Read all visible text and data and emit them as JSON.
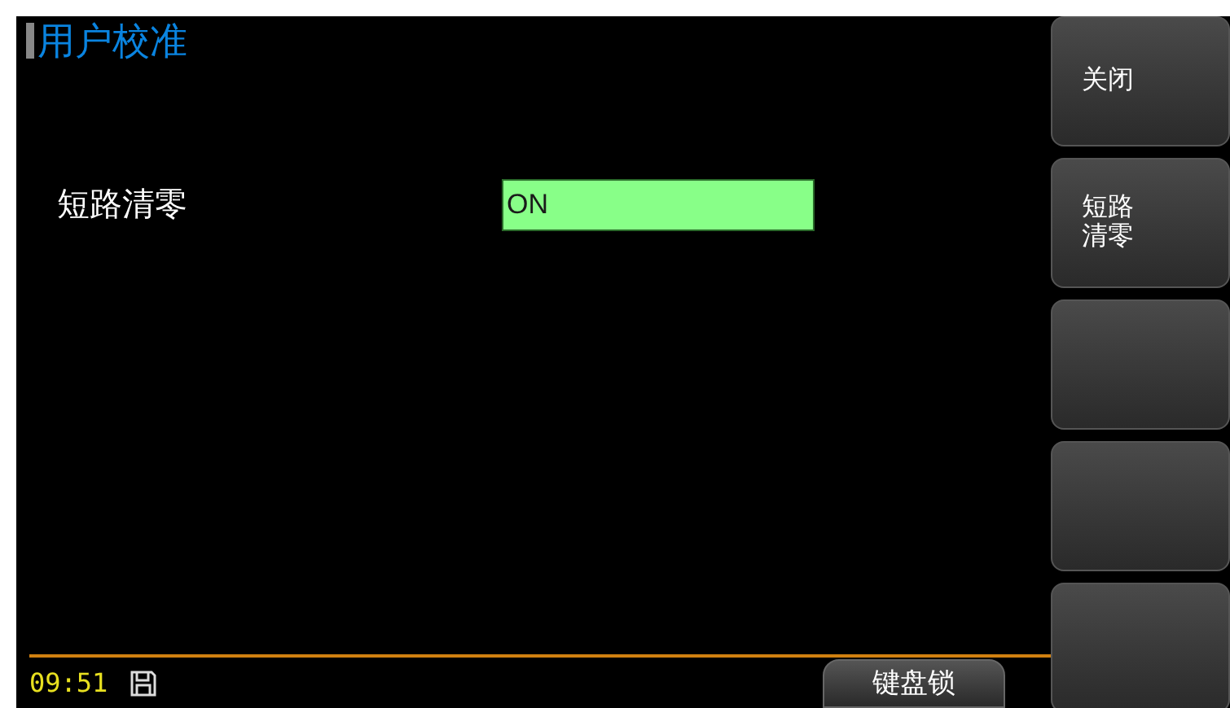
{
  "title": "用户校准",
  "settings": [
    {
      "label": "短路清零",
      "value": "ON",
      "selected": true
    }
  ],
  "status_bar": {
    "time": "09:51",
    "button": "键盘锁"
  },
  "soft_keys": [
    {
      "kind": "label",
      "label": "关闭"
    },
    {
      "kind": "label",
      "label": "短路清零"
    },
    {
      "kind": "blank"
    },
    {
      "kind": "blank"
    },
    {
      "kind": "blank"
    }
  ]
}
